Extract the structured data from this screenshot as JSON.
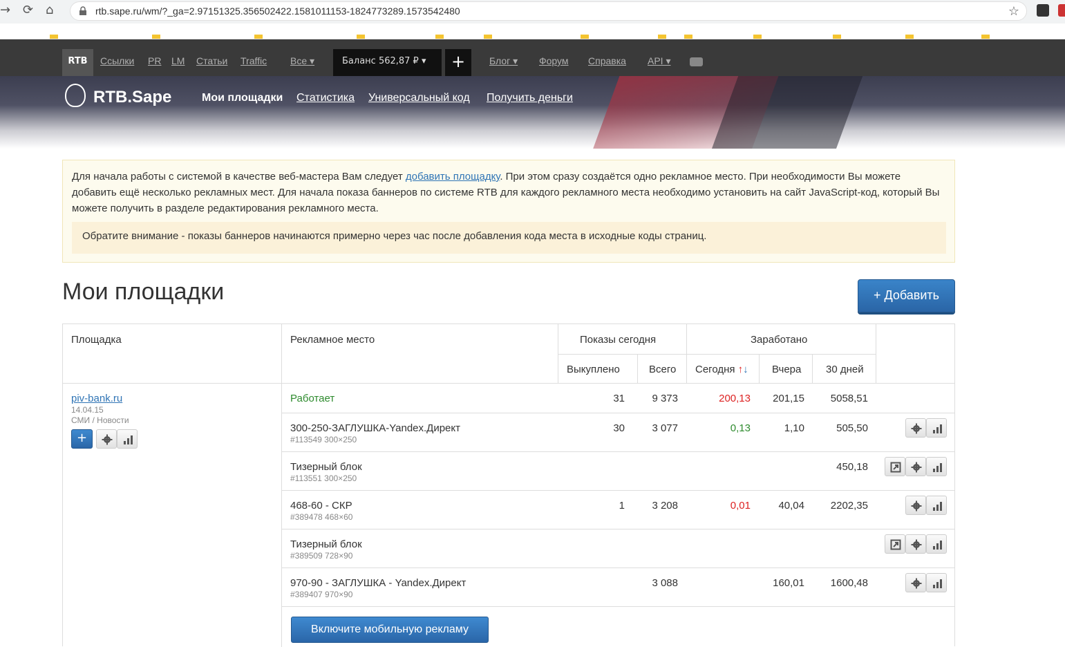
{
  "browser": {
    "url": "rtb.sape.ru/wm/?_ga=2.97151325.356502422.1581011153-1824773289.1573542480"
  },
  "topbar": {
    "rtb": "RTB",
    "links": [
      "Ссылки",
      "PR",
      "LM",
      "Статьи",
      "Traffic"
    ],
    "all": "Все ▾",
    "balance": "Баланс  562,87 ₽ ▾",
    "plus": "+",
    "right_links": [
      "Блог ▾",
      "Форум",
      "Справка",
      "API ▾"
    ]
  },
  "header": {
    "logo": "RTB.Sape",
    "nav_active": "Мои площадки",
    "nav": [
      "Статистика",
      "Универсальный код",
      "Получить деньги"
    ]
  },
  "notice": {
    "text_before": "Для начала работы с системой в качестве веб-мастера Вам следует ",
    "link": "добавить площадку",
    "text_after": ". При этом сразу создаётся одно рекламное место. При необходимости Вы можете добавить ещё несколько рекламных мест. Для начала показа баннеров по системе RTB для каждого рекламного места необходимо установить на сайт JavaScript-код, который Вы можете получить в разделе редактирования рекламного места.",
    "inner": "Обратите внимание - показы баннеров начинаются примерно через час после добавления кода места в исходные коды страниц."
  },
  "page": {
    "title": "Мои площадки",
    "add_button": "+ Добавить"
  },
  "table": {
    "headers": {
      "site": "Площадка",
      "place": "Рекламное место",
      "shows_today": "Показы сегодня",
      "earned": "Заработано",
      "bought": "Выкуплено",
      "total": "Всего",
      "today": "Сегодня",
      "yesterday": "Вчера",
      "days30": "30 дней"
    },
    "site": {
      "name": "piv-bank.ru",
      "date": "14.04.15",
      "category": "СМИ / Новости",
      "add": "+"
    },
    "summary": {
      "status": "Работает",
      "bought": "31",
      "total": "9 373",
      "today": "200,13",
      "yesterday": "201,15",
      "days30": "5058,51"
    },
    "rows": [
      {
        "name": "300-250-ЗАГЛУШКА-Yandex.Директ",
        "sub": "#113549 300×250",
        "bought": "30",
        "total": "3 077",
        "today": "0,13",
        "yesterday": "1,10",
        "days30": "505,50"
      },
      {
        "name": "Тизерный блок",
        "sub": "#113551 300×250",
        "bought": "",
        "total": "",
        "today": "",
        "yesterday": "",
        "days30": "450,18"
      },
      {
        "name": "468-60 - СКР",
        "sub": "#389478 468×60",
        "bought": "1",
        "total": "3 208",
        "today": "0,01",
        "yesterday": "40,04",
        "days30": "2202,35"
      },
      {
        "name": "Тизерный блок",
        "sub": "#389509 728×90",
        "bought": "",
        "total": "",
        "today": "",
        "yesterday": "",
        "days30": ""
      },
      {
        "name": "970-90 - ЗАГЛУШКА - Yandex.Директ",
        "sub": "#389407 970×90",
        "bought": "",
        "total": "3 088",
        "today": "",
        "yesterday": "160,01",
        "days30": "1600,48"
      }
    ],
    "mobile_button": "Включите мобильную рекламу"
  },
  "colors": {
    "accent": "#2f74b5",
    "positive": "#2e8b2e",
    "negative": "#dd2222"
  }
}
